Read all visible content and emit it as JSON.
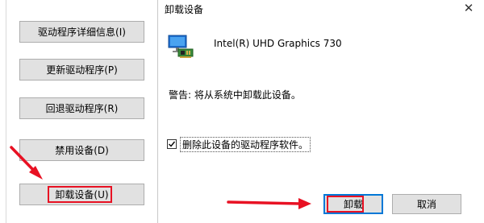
{
  "properties": {
    "buttons": [
      {
        "label": "驱动程序详细信息(I)"
      },
      {
        "label": "更新驱动程序(P)"
      },
      {
        "label": "回退驱动程序(R)"
      },
      {
        "label": "禁用设备(D)"
      },
      {
        "label": "卸载设备(U)"
      }
    ]
  },
  "dialog": {
    "title": "卸载设备",
    "close_glyph": "✕",
    "device_icon": "display-adapter-icon",
    "device_name": "Intel(R) UHD Graphics 730",
    "warning": "警告: 将从系统中卸载此设备。",
    "checkbox": {
      "label": "删除此设备的驱动程序软件。",
      "checked": true
    },
    "confirm_label": "卸载",
    "cancel_label": "取消"
  },
  "colors": {
    "highlight_red": "#e81123",
    "focus_blue": "#0078d7",
    "button_face": "#e1e1e1"
  }
}
